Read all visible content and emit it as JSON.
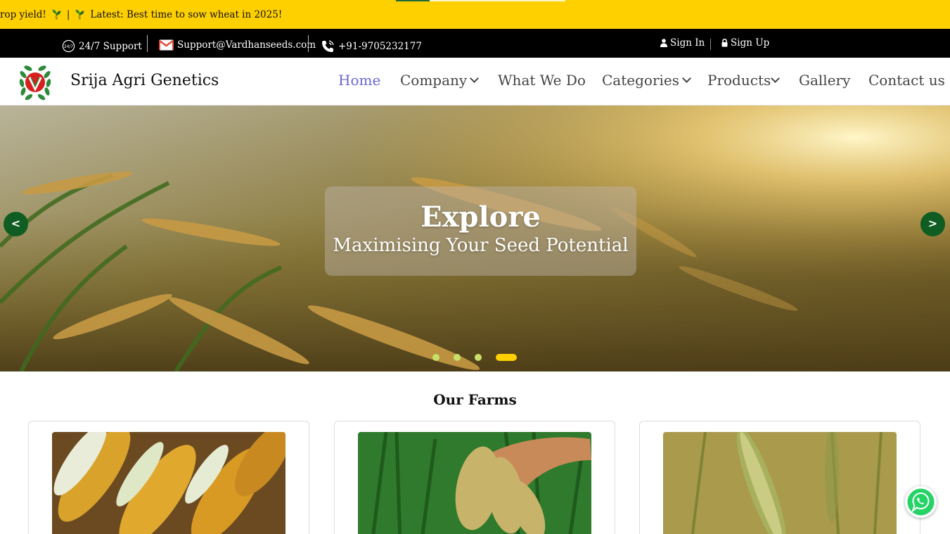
{
  "ticker": {
    "text_1": "rop yield!",
    "separator": "|",
    "text_2": "Latest: Best time to sow wheat in 2025!"
  },
  "topbar": {
    "support": "24/7 Support",
    "email": "Support@Vardhanseeds.com",
    "phone": "+91-9705232177",
    "sign_in": "Sign In",
    "sign_up": "Sign Up"
  },
  "navbar": {
    "brand": "Srija Agri Genetics",
    "items": [
      {
        "label": "Home",
        "active": true
      },
      {
        "label": "Company"
      },
      {
        "label": "What We Do"
      },
      {
        "label": "Categories"
      },
      {
        "label": "Products"
      },
      {
        "label": "Gallery"
      },
      {
        "label": "Contact us"
      }
    ]
  },
  "hero": {
    "title": "Explore",
    "subtitle": "Maximising Your Seed Potential",
    "prev": "<",
    "next": ">",
    "slide_count": 4,
    "active_slide": 4
  },
  "farms": {
    "title": "Our Farms",
    "cards": [
      {
        "image": "corn"
      },
      {
        "image": "rice-in-hand"
      },
      {
        "image": "wheat"
      }
    ]
  },
  "colors": {
    "ticker_bg": "#ffd000",
    "topbar_bg": "#000000",
    "nav_active": "#6a67d6",
    "arrow_bg": "#0f5d22",
    "dot_active": "#ffd000"
  }
}
